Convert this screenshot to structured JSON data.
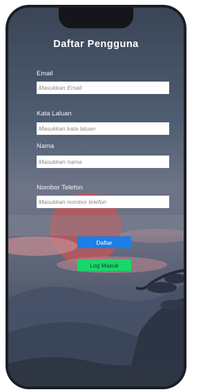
{
  "form": {
    "title": "Daftar Pengguna",
    "fields": [
      {
        "label": "Email",
        "placeholder": "Masukkan Email"
      },
      {
        "label": "Kata Laluan",
        "placeholder": "Masukkan kata laluan"
      },
      {
        "label": "Nama",
        "placeholder": "Masukkan nama"
      },
      {
        "label": "Nombor Telefon",
        "placeholder": "Masukkan nombor telefon"
      }
    ]
  },
  "buttons": {
    "register_label": "Daftar",
    "login_label": "Log Masuk"
  },
  "colors": {
    "register_button": "#1a7fe6",
    "login_button": "#19d86a"
  }
}
